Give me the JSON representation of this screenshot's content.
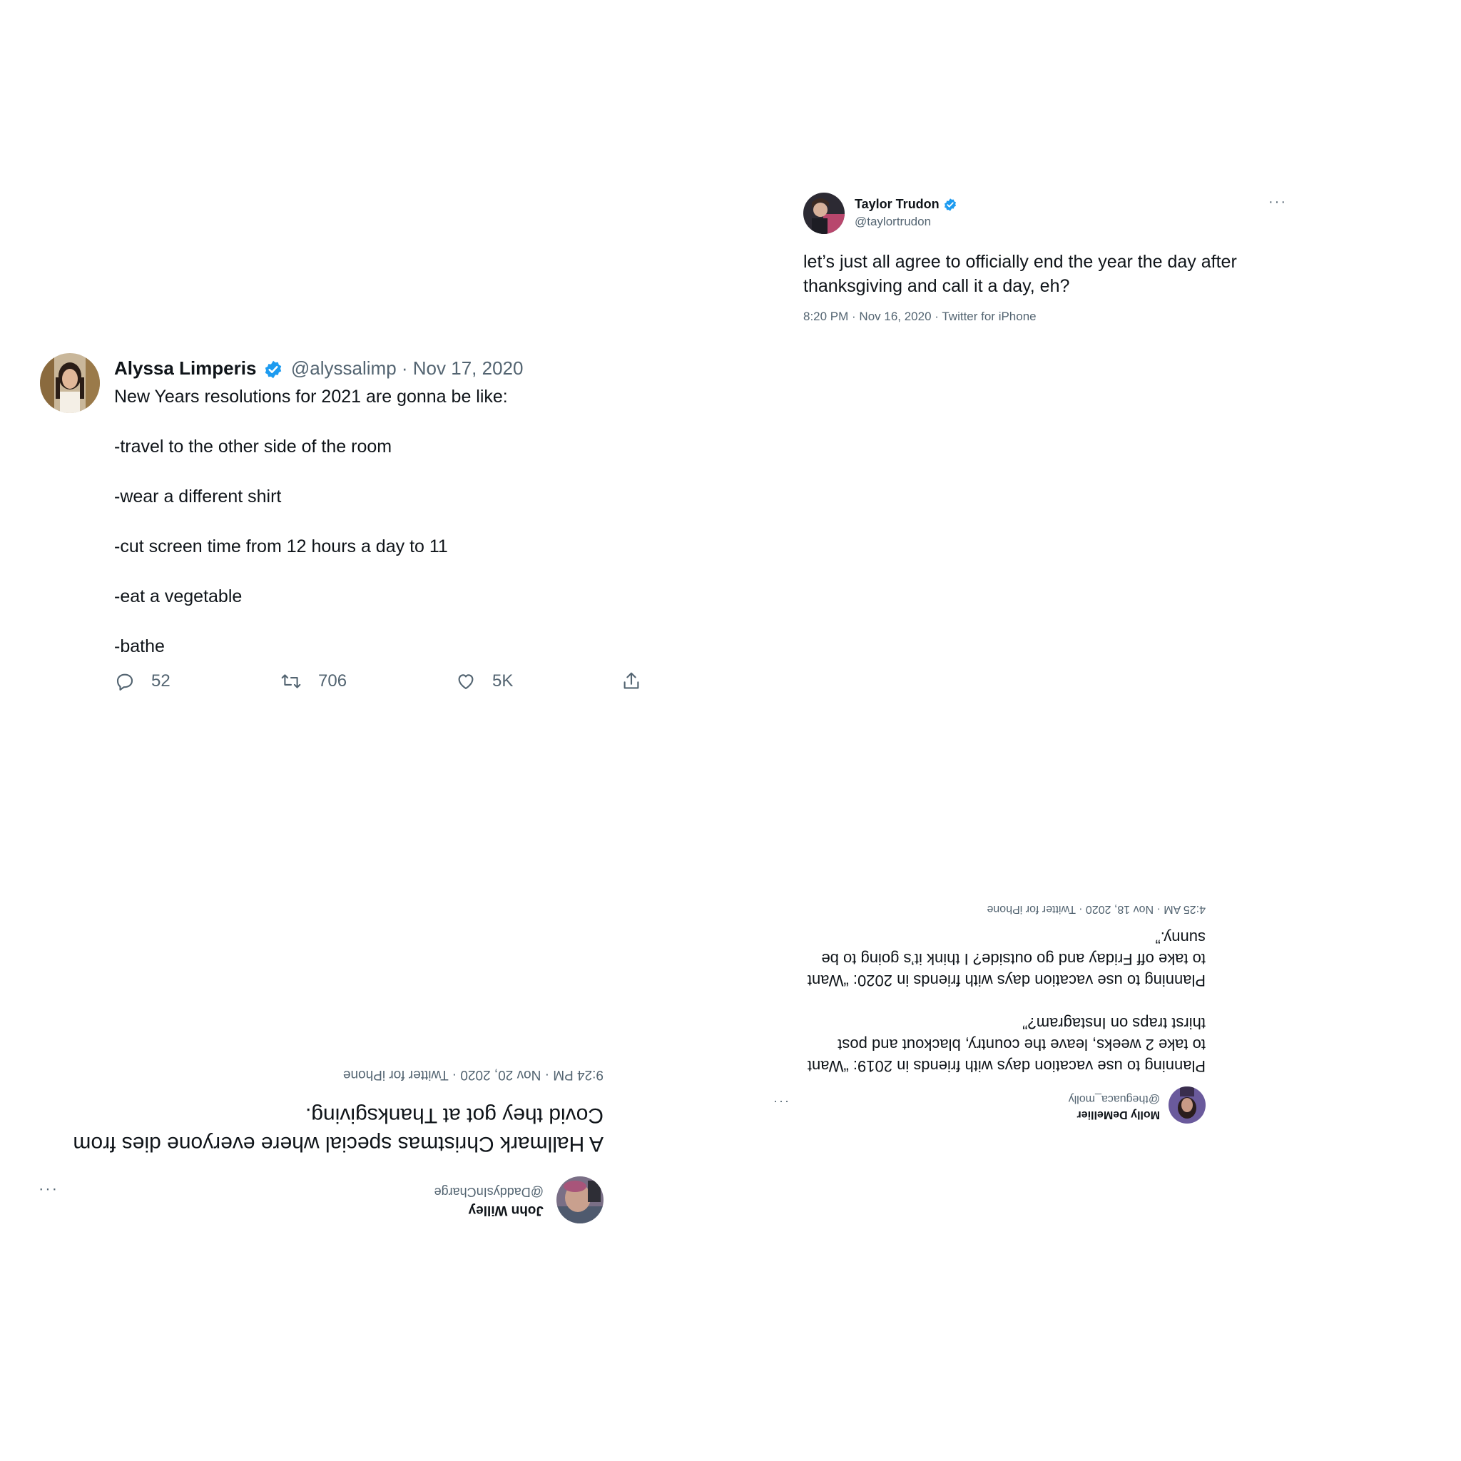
{
  "tweets": {
    "taylor": {
      "name": "Taylor Trudon",
      "handle": "@taylortrudon",
      "lines": [
        "let’s just all agree to officially end the year the day after",
        "thanksgiving and call it a day, eh?"
      ],
      "meta": "8:20 PM · Nov 16, 2020 · Twitter for iPhone",
      "more": "···"
    },
    "alyssa": {
      "name": "Alyssa Limperis",
      "handle": "@alyssalimp",
      "date_sep": " · ",
      "date": "Nov 17, 2020",
      "lines": [
        "New Years resolutions for 2021 are gonna be like:",
        "-travel to the other side of the room",
        "-wear a different shirt",
        "-cut screen time from 12 hours a day to 11",
        "-eat a vegetable",
        "-bathe"
      ],
      "actions": {
        "replies": "52",
        "retweets": "706",
        "likes": "5K"
      }
    },
    "john": {
      "name": "John Willey",
      "handle": "@DaddysInCharge",
      "lines": [
        "A Hallmark Christmas special where everyone dies from",
        "Covid they got at Thanksgiving."
      ],
      "meta": "9:24 PM · Nov 20, 2020 · Twitter for iPhone",
      "more": "···"
    },
    "molly": {
      "name": "Molly DeMellier",
      "handle": "@theguaca_molly",
      "lines": [
        "Planning to use vacation days with friends in 2019: “Want",
        "to take 2 weeks, leave the country, blackout and post",
        "thirst traps on Instagram?”",
        "Planning to use vacation days with friends in 2020: “Want",
        "to take off Friday and go outside? I think it’s going to be",
        "sunny.”"
      ],
      "meta": "4:25 AM · Nov 18, 2020 · Twitter for iPhone",
      "more": "···"
    }
  },
  "colors": {
    "verified": "#1d9bf0",
    "muted": "#536471",
    "text": "#0f1419"
  }
}
